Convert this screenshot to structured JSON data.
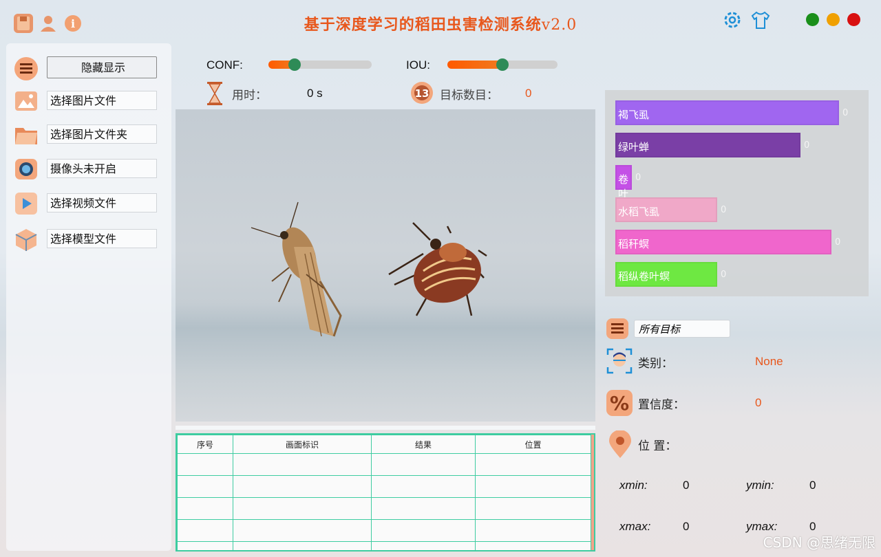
{
  "title": {
    "main": "基于深度学习的稻田虫害检测系统",
    "version": "v2.0"
  },
  "toolbar_icons": [
    "save-icon",
    "user-icon",
    "info-icon"
  ],
  "window_controls": {
    "colors": [
      "#1a8f1a",
      "#f0a000",
      "#d81010"
    ]
  },
  "sidebar": {
    "toggle_label": "隐藏显示",
    "items": [
      {
        "label": "选择图片文件",
        "icon": "image-file-icon"
      },
      {
        "label": "选择图片文件夹",
        "icon": "folder-icon"
      },
      {
        "label": "摄像头未开启",
        "icon": "camera-icon"
      },
      {
        "label": "选择视频文件",
        "icon": "video-play-icon"
      },
      {
        "label": "选择模型文件",
        "icon": "model-cube-icon"
      }
    ]
  },
  "params": {
    "conf_label": "CONF:",
    "conf_value": 0.25,
    "iou_label": "IOU:",
    "iou_value": 0.5
  },
  "stats": {
    "time_label": "用时：",
    "time_value": "0 s",
    "count_label": "目标数目：",
    "count_value": "0"
  },
  "table": {
    "headers": [
      "序号",
      "画面标识",
      "结果",
      "位置"
    ],
    "rows": [
      [
        "",
        "",
        "",
        ""
      ],
      [
        "",
        "",
        "",
        ""
      ],
      [
        "",
        "",
        "",
        ""
      ],
      [
        "",
        "",
        "",
        ""
      ],
      [
        "",
        "",
        "",
        ""
      ]
    ]
  },
  "chart_data": {
    "type": "bar",
    "orientation": "horizontal",
    "categories": [
      "褐飞虱",
      "绿叶蝉",
      "卷叶螟",
      "水稻飞虱",
      "稻秆螟",
      "稻纵卷叶螟"
    ],
    "values": [
      0,
      0,
      0,
      0,
      0,
      0
    ],
    "colors": [
      "#a066f0",
      "#7a3fa6",
      "#c450e6",
      "#f0a8c8",
      "#f066cc",
      "#6ee842"
    ]
  },
  "filter": {
    "selected": "所有目标"
  },
  "detail": {
    "class_label": "类别：",
    "class_value": "None",
    "conf_label": "置信度：",
    "conf_value": "0",
    "pos_label": "位 置：",
    "xmin_label": "xmin:",
    "xmin_value": "0",
    "ymin_label": "ymin:",
    "ymin_value": "0",
    "xmax_label": "xmax:",
    "xmax_value": "0",
    "ymax_label": "ymax:",
    "ymax_value": "0"
  },
  "watermark": "CSDN @思绪无限"
}
